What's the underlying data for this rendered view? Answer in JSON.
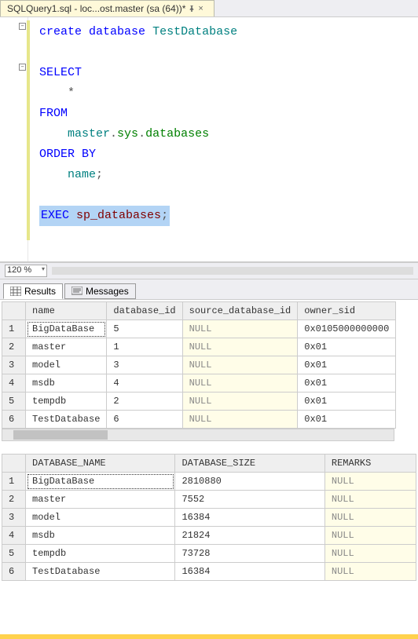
{
  "tab": {
    "label": "SQLQuery1.sql - loc...ost.master (sa (64))*",
    "close_glyph": "×"
  },
  "editor": {
    "lines": [
      {
        "type": "code",
        "seg": [
          [
            "kw",
            "create"
          ],
          [
            "plain",
            " "
          ],
          [
            "kw",
            "database"
          ],
          [
            "plain",
            " "
          ],
          [
            "ident",
            "TestDatabase"
          ]
        ]
      },
      {
        "type": "blank"
      },
      {
        "type": "code",
        "seg": [
          [
            "kw",
            "SELECT"
          ]
        ]
      },
      {
        "type": "code",
        "indent": 1,
        "seg": [
          [
            "punct",
            "*"
          ]
        ]
      },
      {
        "type": "code",
        "seg": [
          [
            "kw",
            "FROM"
          ]
        ]
      },
      {
        "type": "code",
        "indent": 1,
        "seg": [
          [
            "ident",
            "master"
          ],
          [
            "punct",
            "."
          ],
          [
            "sys",
            "sys"
          ],
          [
            "punct",
            "."
          ],
          [
            "sys",
            "databases"
          ]
        ]
      },
      {
        "type": "code",
        "seg": [
          [
            "kw",
            "ORDER"
          ],
          [
            "plain",
            " "
          ],
          [
            "kw",
            "BY"
          ]
        ]
      },
      {
        "type": "code",
        "indent": 1,
        "seg": [
          [
            "ident",
            "name"
          ],
          [
            "punct",
            ";"
          ]
        ]
      },
      {
        "type": "blank"
      },
      {
        "type": "code",
        "highlight": true,
        "seg": [
          [
            "kw",
            "EXEC"
          ],
          [
            "plain",
            " "
          ],
          [
            "proc",
            "sp_databases"
          ],
          [
            "punct",
            ";"
          ]
        ]
      }
    ]
  },
  "zoom": {
    "value": "120 %",
    "dropdown_arrow": "▾"
  },
  "panel_tabs": {
    "results": "Results",
    "messages": "Messages"
  },
  "grid1": {
    "headers": [
      "name",
      "database_id",
      "source_database_id",
      "owner_sid"
    ],
    "rows": [
      {
        "n": "1",
        "name": "BigDataBase",
        "database_id": "5",
        "source_database_id": "NULL",
        "owner_sid": "0x0105000000000"
      },
      {
        "n": "2",
        "name": "master",
        "database_id": "1",
        "source_database_id": "NULL",
        "owner_sid": "0x01"
      },
      {
        "n": "3",
        "name": "model",
        "database_id": "3",
        "source_database_id": "NULL",
        "owner_sid": "0x01"
      },
      {
        "n": "4",
        "name": "msdb",
        "database_id": "4",
        "source_database_id": "NULL",
        "owner_sid": "0x01"
      },
      {
        "n": "5",
        "name": "tempdb",
        "database_id": "2",
        "source_database_id": "NULL",
        "owner_sid": "0x01"
      },
      {
        "n": "6",
        "name": "TestDatabase",
        "database_id": "6",
        "source_database_id": "NULL",
        "owner_sid": "0x01"
      }
    ]
  },
  "grid2": {
    "headers": [
      "DATABASE_NAME",
      "DATABASE_SIZE",
      "REMARKS"
    ],
    "rows": [
      {
        "n": "1",
        "DATABASE_NAME": "BigDataBase",
        "DATABASE_SIZE": "2810880",
        "REMARKS": "NULL"
      },
      {
        "n": "2",
        "DATABASE_NAME": "master",
        "DATABASE_SIZE": "7552",
        "REMARKS": "NULL"
      },
      {
        "n": "3",
        "DATABASE_NAME": "model",
        "DATABASE_SIZE": "16384",
        "REMARKS": "NULL"
      },
      {
        "n": "4",
        "DATABASE_NAME": "msdb",
        "DATABASE_SIZE": "21824",
        "REMARKS": "NULL"
      },
      {
        "n": "5",
        "DATABASE_NAME": "tempdb",
        "DATABASE_SIZE": "73728",
        "REMARKS": "NULL"
      },
      {
        "n": "6",
        "DATABASE_NAME": "TestDatabase",
        "DATABASE_SIZE": "16384",
        "REMARKS": "NULL"
      }
    ]
  },
  "null_text": "NULL"
}
